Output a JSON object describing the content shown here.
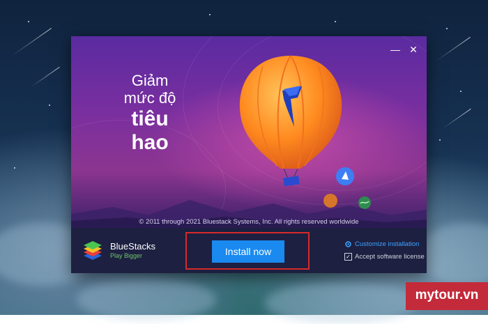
{
  "window": {
    "minimize_label": "—",
    "close_label": "✕"
  },
  "banner": {
    "headline_line1": "Giảm",
    "headline_line2": "mức độ",
    "headline_line3": "tiêu",
    "headline_line4": "hao",
    "copyright": "© 2011 through 2021 Bluestack Systems, Inc. All rights reserved worldwide"
  },
  "footer": {
    "brand_name": "BlueStacks",
    "brand_tagline": "Play Bigger",
    "install_label": "Install now",
    "customize_label": "Customize installation",
    "license_label": "Accept software license",
    "license_checked": "✓"
  },
  "watermark": {
    "text": "mytour.vn"
  },
  "colors": {
    "accent": "#1a8af0",
    "highlight_box": "#d72a2a",
    "brand_green": "#6ec56a",
    "link_blue": "#3ea3ff",
    "watermark_red": "#c32a3a"
  },
  "icons": [
    "minimize-icon",
    "close-icon",
    "gear-icon",
    "checkbox-icon",
    "bluestacks-logo",
    "hot-air-balloon-illustration"
  ]
}
